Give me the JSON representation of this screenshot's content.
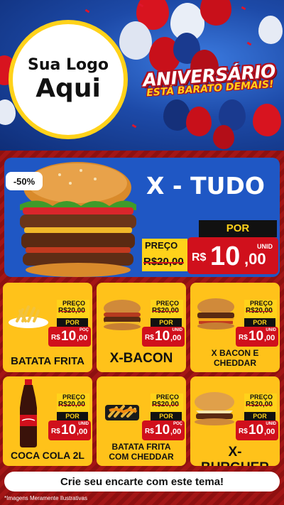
{
  "header": {
    "logo_line1": "Sua Logo",
    "logo_line2": "Aqui",
    "headline": "ANIVERSÁRIO",
    "subheadline": "ESTÁ BARATO DEMAIS!"
  },
  "featured": {
    "name": "X - TUDO",
    "discount": "-50%",
    "price_label": "PREÇO",
    "old_price": "R$20,00",
    "por_label": "POR",
    "currency": "R$",
    "price_int": "10",
    "price_dec": ",00",
    "unit": "UNID"
  },
  "products": [
    {
      "name": "BATATA FRITA",
      "price_label": "PREÇO",
      "old_price": "R$20,00",
      "por_label": "POR",
      "currency": "R$",
      "price_int": "10",
      "price_dec": ",00",
      "unit": "POÇ"
    },
    {
      "name": "X-BACON",
      "price_label": "PREÇO",
      "old_price": "R$20,00",
      "por_label": "POR",
      "currency": "R$",
      "price_int": "10",
      "price_dec": ",00",
      "unit": "UNID"
    },
    {
      "name": "X BACON E CHEDDAR",
      "price_label": "PREÇO",
      "old_price": "R$20,00",
      "por_label": "POR",
      "currency": "R$",
      "price_int": "10",
      "price_dec": ",00",
      "unit": "UNID"
    },
    {
      "name": "COCA COLA 2L",
      "price_label": "PREÇO",
      "old_price": "R$20,00",
      "por_label": "POR",
      "currency": "R$",
      "price_int": "10",
      "price_dec": ",00",
      "unit": "UNID"
    },
    {
      "name": "BATATA FRITA COM CHEDDAR",
      "price_label": "PREÇO",
      "old_price": "R$20,00",
      "por_label": "POR",
      "currency": "R$",
      "price_int": "10",
      "price_dec": ",00",
      "unit": "POÇ"
    },
    {
      "name": "X-BURGUER",
      "price_label": "PREÇO",
      "old_price": "R$20,00",
      "por_label": "POR",
      "currency": "R$",
      "price_int": "10",
      "price_dec": ",00",
      "unit": "UNID"
    }
  ],
  "footer": {
    "cta": "Crie seu encarte com este tema!",
    "disclaimer": "*Imagens Meramente Ilustrativas"
  },
  "colors": {
    "red": "#d0101c",
    "yellow": "#ffc21a",
    "blue": "#1f57c4",
    "black": "#111111"
  },
  "icons": [
    "burger-image",
    "fries-image",
    "bacon-burger-image",
    "cheddar-burger-image",
    "cola-bottle-image",
    "fries-cheddar-image",
    "cheeseburger-image",
    "balloon-decoration"
  ]
}
